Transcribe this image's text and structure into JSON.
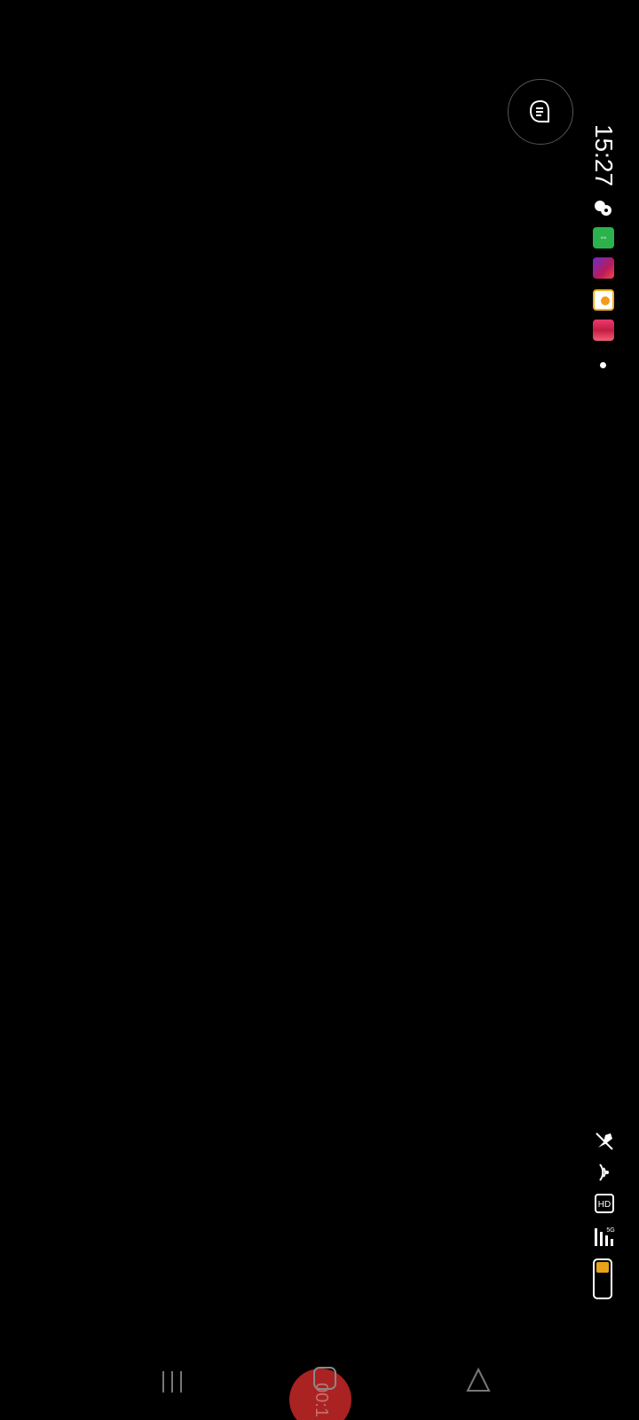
{
  "status_bar": {
    "time": "15:27",
    "orientation": "rotated-90"
  },
  "notifications": [
    {
      "name": "game-controller-icon"
    },
    {
      "name": "wechat-app-icon",
      "color": "#2bb24c"
    },
    {
      "name": "red-app-icon"
    },
    {
      "name": "yellow-app-icon"
    },
    {
      "name": "pink-app-icon"
    },
    {
      "name": "more-notifications-dot"
    }
  ],
  "system_icons": {
    "mute": "mute-icon",
    "wifi": "wifi-icon",
    "hd": "hd-icon",
    "signal": "signal-5g-icon",
    "signal_label": "5G",
    "battery_level": 0.25,
    "battery_color": "#e8a31a"
  },
  "floating_button": {
    "icon": "assistant-bubble-icon"
  },
  "navigation": {
    "recent": "recent-apps-icon",
    "home": "home-icon",
    "back": "back-icon"
  },
  "recorder": {
    "timer": "00:1",
    "color": "#c82828"
  }
}
